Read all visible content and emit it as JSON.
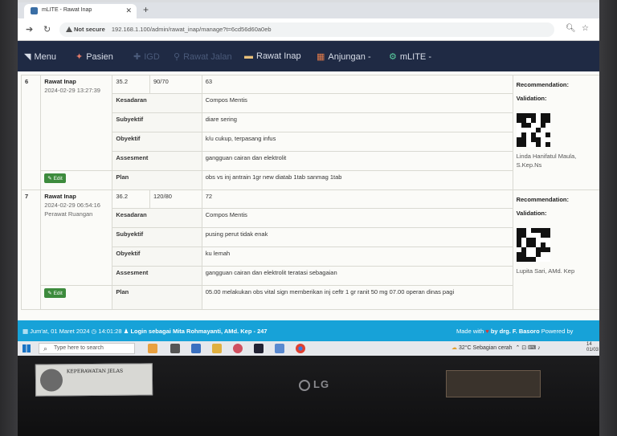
{
  "browser": {
    "tab_title": "mLITE - Rawat Inap",
    "secure_label": "Not secure",
    "url": "192.168.1.100/admin/rawat_inap/manage?t=6cd56d60a0eb"
  },
  "navbar": {
    "items": [
      {
        "label": "Menu",
        "icon": "menu-icon"
      },
      {
        "label": "Pasien",
        "icon": "users-icon"
      },
      {
        "label": "IGD",
        "icon": "ambulance-icon"
      },
      {
        "label": "Rawat Jalan",
        "icon": "walk-icon"
      },
      {
        "label": "Rawat Inap",
        "icon": "bed-icon"
      },
      {
        "label": "Anjungan -",
        "icon": "kiosk-icon"
      },
      {
        "label": "mLITE -",
        "icon": "gear-icon"
      }
    ]
  },
  "records": [
    {
      "no": "6",
      "type": "Rawat Inap",
      "datetime": "2024-02-29 13:27:39",
      "staff_role": "",
      "vitals": [
        "35.2",
        "90/70",
        "63"
      ],
      "fields": [
        {
          "label": "Kesadaran",
          "value": "Compos Mentis"
        },
        {
          "label": "Subyektif",
          "value": "diare sering"
        },
        {
          "label": "Obyektif",
          "value": "k/u cukup, terpasang infus"
        },
        {
          "label": "Assesment",
          "value": "gangguan cairan dan elektrolit"
        },
        {
          "label": "Plan",
          "value": "obs vs inj antrain 1gr new diatab 1tab sanmag 1tab"
        }
      ],
      "edit_label": "Edit",
      "recommendation_label": "Recommendation:",
      "validation_label": "Validation:",
      "signer": "Linda Hanifatul Maula, S.Kep.Ns"
    },
    {
      "no": "7",
      "type": "Rawat Inap",
      "datetime": "2024-02-29 06:54:16",
      "staff_role": "Perawat Ruangan",
      "vitals": [
        "36.2",
        "120/80",
        "72"
      ],
      "fields": [
        {
          "label": "Kesadaran",
          "value": "Compos Mentis"
        },
        {
          "label": "Subyektif",
          "value": "pusing perut tidak enak"
        },
        {
          "label": "Obyektif",
          "value": "ku lemah"
        },
        {
          "label": "Assesment",
          "value": "gangguan cairan dan elektrolit teratasi sebagaian"
        },
        {
          "label": "Plan",
          "value": "05.00 melakukan obs vital sign memberikan inj ceftr 1 gr ranit 50 mg 07.00 operan dinas pagi"
        }
      ],
      "edit_label": "Edit",
      "recommendation_label": "Recommendation:",
      "validation_label": "Validation:",
      "signer": "Lupita Sari, AMd. Kep"
    }
  ],
  "footer": {
    "date": "Jum'at, 01 Maret 2024",
    "time": "14:01:28",
    "login": "Login sebagai Mita Rohmayanti, AMd. Kep - 247",
    "made_with": "Made with",
    "by": "by drg. F. Basoro",
    "powered": "Powered by"
  },
  "taskbar": {
    "search_placeholder": "Type here to search",
    "weather": "32°C  Sebagian cerah",
    "clock_top": "14",
    "clock_bottom": "01/03"
  },
  "photo": {
    "sticker_left": "KEPERAWATAN JELAS",
    "monitor_brand": "LG"
  }
}
